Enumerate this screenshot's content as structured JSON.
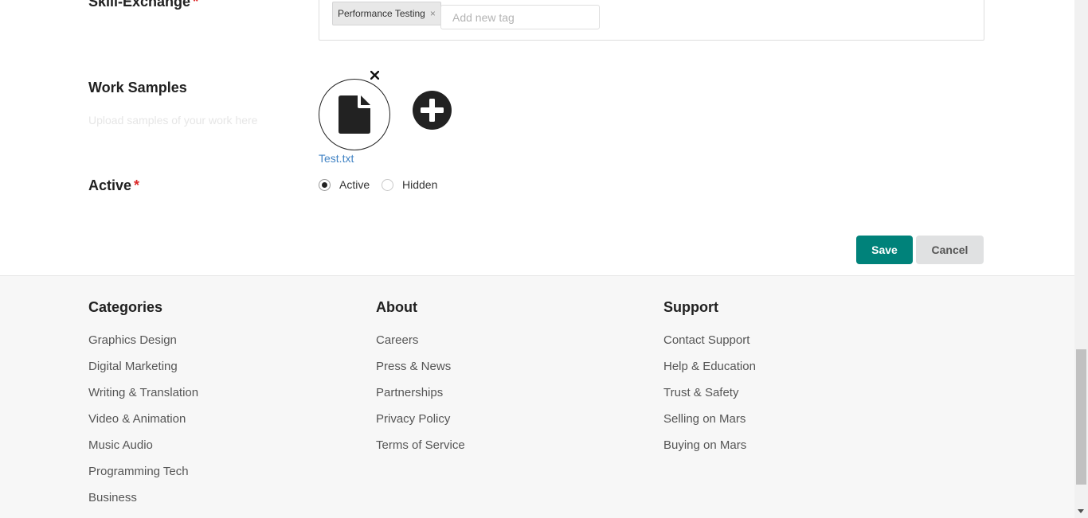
{
  "form": {
    "skill_exchange": {
      "label": "Skill-Exchange",
      "required_mark": "*",
      "tags": [
        "Performance Testing"
      ],
      "tag_remove": "×",
      "add_tag_placeholder": "Add new tag"
    },
    "work_samples": {
      "label": "Work Samples",
      "hint": "Upload samples of your work here",
      "files": [
        "Test.txt"
      ]
    },
    "active": {
      "label": "Active",
      "required_mark": "*",
      "options": [
        "Active",
        "Hidden"
      ],
      "selected": "Active"
    },
    "buttons": {
      "save": "Save",
      "cancel": "Cancel"
    }
  },
  "footer": {
    "categories": {
      "title": "Categories",
      "items": [
        "Graphics Design",
        "Digital Marketing",
        "Writing & Translation",
        "Video & Animation",
        "Music Audio",
        "Programming Tech",
        "Business"
      ]
    },
    "about": {
      "title": "About",
      "items": [
        "Careers",
        "Press & News",
        "Partnerships",
        "Privacy Policy",
        "Terms of Service"
      ]
    },
    "support": {
      "title": "Support",
      "items": [
        "Contact Support",
        "Help & Education",
        "Trust & Safety",
        "Selling on Mars",
        "Buying on Mars"
      ]
    }
  },
  "colors": {
    "primary": "#00827a",
    "link": "#4183c4",
    "required": "#db2828",
    "footer_bg": "#f7f7f7"
  },
  "icons": {
    "sample": "file-icon",
    "remove_sample": "close-icon",
    "add_sample": "plus-circle-icon"
  }
}
